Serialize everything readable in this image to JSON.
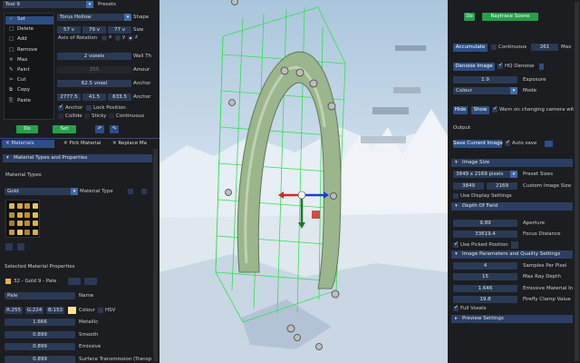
{
  "tool": {
    "selected": "Tool 9",
    "presets_label": "Presets",
    "menu": [
      {
        "icon": "✓",
        "label": "Set"
      },
      {
        "icon": "□",
        "label": "Delete"
      },
      {
        "icon": "□",
        "label": "Add"
      },
      {
        "icon": "□",
        "label": "Remove"
      },
      {
        "icon": "✕",
        "label": "Max"
      },
      {
        "icon": "✎",
        "label": "Paint"
      },
      {
        "icon": "✂",
        "label": "Cut"
      },
      {
        "icon": "⧉",
        "label": "Copy"
      },
      {
        "icon": "⎘",
        "label": "Paste"
      }
    ],
    "shape": "Torus Hollow",
    "shape_label": "Shape",
    "axis_label": "Axis of Rotation",
    "axes": [
      "x",
      "y",
      "z"
    ],
    "size": [
      "57 v",
      "79 v",
      "77 v"
    ],
    "size_label": "Size",
    "wall_value": "2 voxels",
    "wall_label": "Wall Th",
    "amount_value": "255",
    "amount_label": "Amour",
    "anchor1_value": "62.5 voxel",
    "anchor1_label": "Anchor",
    "anchor_pos": [
      "2777.5",
      "41.5",
      "633.5"
    ],
    "anchor_pos_label": "Anchor",
    "options": [
      "Anchor",
      "Lock Position",
      "Collide",
      "Sticky",
      "Continuous"
    ],
    "do_label": "Do",
    "set_label": "Set"
  },
  "left_tabs": [
    "Materials",
    "Pick Material",
    "Replace Ma"
  ],
  "materials": {
    "section": "Material Types and Properties",
    "types_label": "Material Types",
    "type_value": "Gold",
    "type_label": "Material Type",
    "selected_label": "Selected Material Properties",
    "selected_value": "32 - Gold 9 - Pale",
    "name_value": "Pale",
    "name_label": "Name",
    "colour": [
      "R:255",
      "G:224",
      "B:153"
    ],
    "colour_label": "Colour",
    "hsv_label": "HSV",
    "props": [
      {
        "value": "1.666",
        "label": "Metallic"
      },
      {
        "value": "0.899",
        "label": "Smooth"
      },
      {
        "value": "0.899",
        "label": "Emissive"
      },
      {
        "value": "0.899",
        "label": "Surface Transmission (Transp"
      }
    ],
    "swatch_colors": [
      "#e0b54a",
      "#d9a63e",
      "#c99535",
      "#e8c66a",
      "#bb8a2e",
      "#d4a848",
      "#c08f33",
      "#e3bc58",
      "#a87a25",
      "#ceac52",
      "#b78c36",
      "#ddb24d",
      "#c6983f",
      "#e6c263",
      "#b08330",
      "#d8ae4a"
    ]
  },
  "render": {
    "raytrace_label": "Raytrace Scene",
    "do_label": "Do",
    "accumulate_label": "Accumulate",
    "continuous_label": "Continuous",
    "max_value": "261",
    "max_label": "Max",
    "denoise_label": "Denoise Image",
    "hq_denoise_label": "HQ Denoise",
    "exposure_value": "1.9",
    "exposure_label": "Exposure",
    "mode_value": "Colour",
    "mode_label": "Mode",
    "hide_label": "Hide",
    "show_label": "Show",
    "warn_label": "Warn on changing camera wit",
    "output_label": "Output",
    "save_label": "Save Current Image",
    "autosave_label": "Auto save",
    "image_size_hdr": "Image Size",
    "image_size_value": "3849 x 2169 pixels",
    "preset_sizes_label": "Preset Sizes",
    "custom_w": "3849",
    "custom_h": "2169",
    "custom_label": "Custom Image Size",
    "use_display_label": "Use Display Settings",
    "dof_hdr": "Depth Of Field",
    "aperture_value": "9.89",
    "aperture_label": "Aperture",
    "focus_value": "33619.4",
    "focus_label": "Focus Distance",
    "picked_label": "Use Picked Position",
    "quality_hdr": "Image Parameters and Quality Settings",
    "quality": [
      {
        "value": "4",
        "label": "Samples Per Pixel"
      },
      {
        "value": "15",
        "label": "Max Ray Depth"
      },
      {
        "value": "1.646",
        "label": "Emissive Material In"
      },
      {
        "value": "19.8",
        "label": "Firefly Clamp Value"
      }
    ],
    "full_voxels_label": "Full Voxels",
    "preview_hdr": "Preview Settings"
  },
  "colors": {
    "accent": "#2c4e84",
    "green": "#26a04a",
    "field": "#2a3a55"
  }
}
